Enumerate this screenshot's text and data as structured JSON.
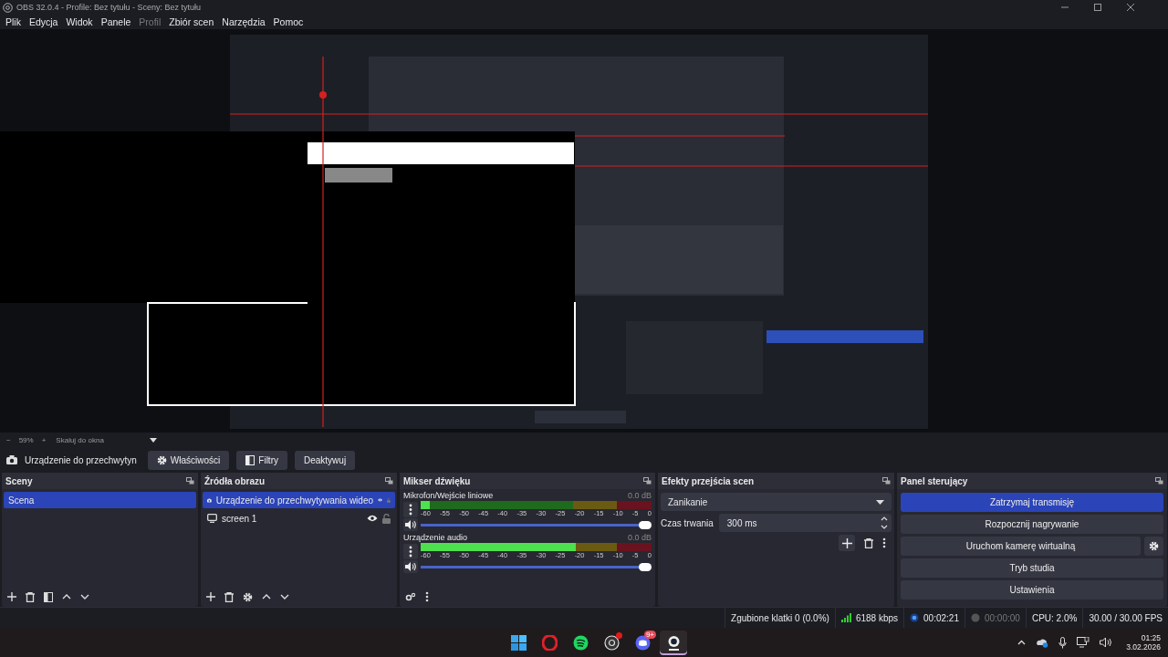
{
  "window": {
    "title": "OBS 32.0.4 - Profile: Bez tytułu - Sceny: Bez tytułu"
  },
  "menu": [
    {
      "label": "Plik",
      "disabled": false
    },
    {
      "label": "Edycja",
      "disabled": false
    },
    {
      "label": "Widok",
      "disabled": false
    },
    {
      "label": "Panele",
      "disabled": false
    },
    {
      "label": "Profil",
      "disabled": true
    },
    {
      "label": "Zbiór scen",
      "disabled": false
    },
    {
      "label": "Narzędzia",
      "disabled": false
    },
    {
      "label": "Pomoc",
      "disabled": false
    }
  ],
  "zoom_bar": {
    "minus": "−",
    "zoom": "59%",
    "plus": "+",
    "scale_mode": "Skaluj do okna"
  },
  "source_toolbar": {
    "source": "Urządzenie do przechwytyn",
    "buttons": [
      {
        "label": "Właściwości",
        "kind": "gear"
      },
      {
        "label": "Filtry",
        "kind": "filter"
      },
      {
        "label": "Deaktywuj",
        "kind": "plain"
      }
    ]
  },
  "scenes": {
    "title": "Sceny",
    "items": [
      {
        "label": "Scena",
        "selected": true
      }
    ]
  },
  "sources": {
    "title": "Źródła obrazu",
    "items": [
      {
        "label": "Urządzenie do przechwytywania wideo",
        "kind": "camera",
        "selected": true,
        "visible": true,
        "locked": false
      },
      {
        "label": "screen 1",
        "kind": "monitor",
        "selected": false,
        "visible": true,
        "locked": false
      }
    ]
  },
  "mixer": {
    "title": "Mikser dźwięku",
    "channels": [
      {
        "name": "Mikrofon/Wejście liniowe",
        "reading": "0.0 dB",
        "level": 0.04,
        "volume": {
          "level": 1
        },
        "muted": false,
        "scale": [
          "-60",
          "-55",
          "-50",
          "-45",
          "-40",
          "-35",
          "-30",
          "-25",
          "-20",
          "-15",
          "-10",
          "-5",
          "0"
        ]
      },
      {
        "name": "Urządzenie audio",
        "reading": "0.0 dB",
        "level": 0.67,
        "volume": {
          "level": 1
        },
        "muted": false,
        "scale": [
          "-60",
          "-55",
          "-50",
          "-45",
          "-40",
          "-35",
          "-30",
          "-25",
          "-20",
          "-15",
          "-10",
          "-5",
          "0"
        ]
      }
    ]
  },
  "transitions": {
    "title": "Efekty przejścia scen",
    "transition": "Zanikanie",
    "duration_label": "Czas trwania",
    "duration": "300 ms"
  },
  "controls": {
    "title": "Panel sterujący",
    "buttons": [
      {
        "label": "Zatrzymaj transmisję",
        "active": true,
        "settings": false
      },
      {
        "label": "Rozpocznij nagrywanie",
        "active": false,
        "settings": false
      },
      {
        "label": "Uruchom kamerę wirtualną",
        "active": false,
        "settings": true
      },
      {
        "label": "Tryb studia",
        "active": false,
        "settings": false
      },
      {
        "label": "Ustawienia",
        "active": false,
        "settings": false
      }
    ]
  },
  "status_bar": {
    "dropped": "Zgubione klatki 0 (0.0%)",
    "bitrate": "6188 kbps",
    "stream": {
      "time": "00:02:21",
      "active": true
    },
    "record": {
      "time": "00:00:00",
      "active": false
    },
    "cpu": "CPU: 2.0%",
    "fps": "30.00 / 30.00 FPS"
  },
  "taskbar": {
    "apps": [
      {
        "kind": "windows",
        "selected": false,
        "notification": false
      },
      {
        "kind": "opera",
        "selected": false,
        "notification": false
      },
      {
        "kind": "spotify",
        "selected": false,
        "notification": false
      },
      {
        "kind": "obs",
        "selected": false,
        "notification": true
      },
      {
        "kind": "discord",
        "selected": false,
        "badge": "9+"
      },
      {
        "kind": "webcam",
        "selected": true,
        "notification": false
      }
    ],
    "time": "01:25",
    "date": "3.02.2026"
  }
}
